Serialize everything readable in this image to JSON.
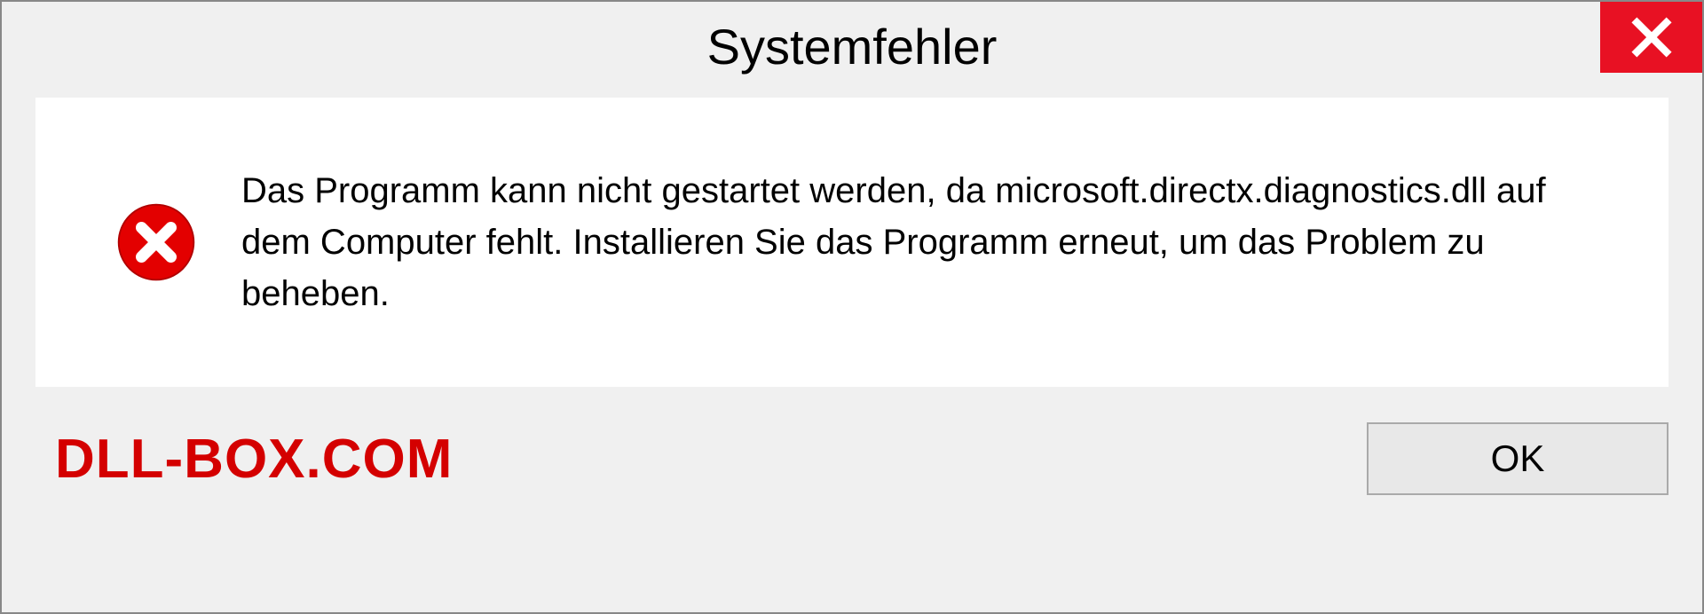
{
  "dialog": {
    "title": "Systemfehler",
    "message": "Das Programm kann nicht gestartet werden, da microsoft.directx.diagnostics.dll auf dem Computer fehlt. Installieren Sie das Programm erneut, um das Problem zu beheben.",
    "ok_label": "OK"
  },
  "watermark": "DLL-BOX.COM",
  "colors": {
    "close_bg": "#e81123",
    "error_icon": "#e30000",
    "watermark": "#d40000"
  }
}
